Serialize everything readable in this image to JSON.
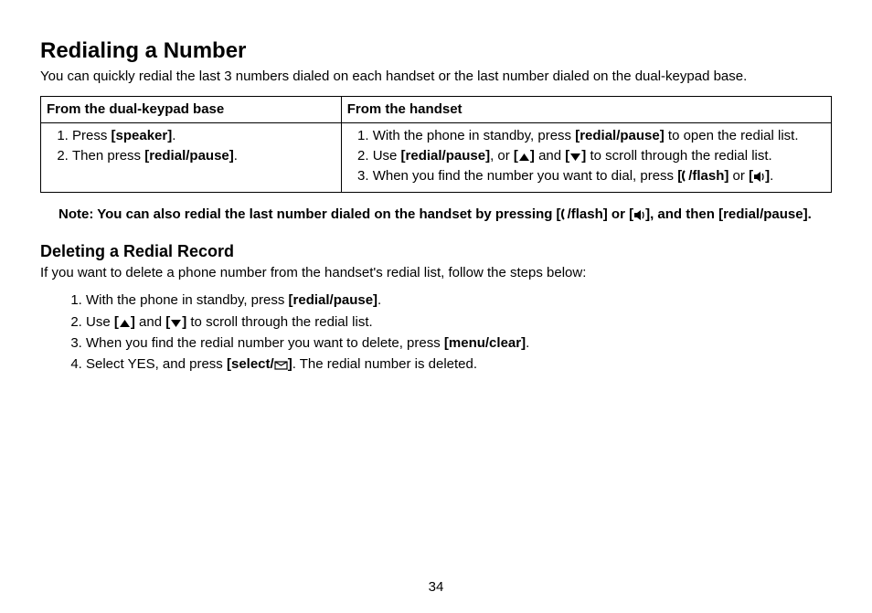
{
  "title": "Redialing a Number",
  "intro": "You can quickly redial the last 3 numbers dialed on each handset or the last number dialed on the dual-keypad base.",
  "table": {
    "head": [
      "From the dual-keypad base",
      "From the handset"
    ],
    "col1": {
      "s1a": "Press ",
      "s1b": "[speaker]",
      "s1c": ".",
      "s2a": "Then press ",
      "s2b": "[redial/pause]",
      "s2c": "."
    },
    "col2": {
      "s1a": "With the phone in standby, press ",
      "s1b": "[redial/pause]",
      "s1c": " to open the redial list.",
      "s2a": "Use ",
      "s2b": "[redial/pause]",
      "s2c": ", or ",
      "s2d_open": "[",
      "s2d_close": "]",
      "s2e": " and ",
      "s2f_open": "[",
      "s2f_close": "]",
      "s2g": " to scroll through the redial list.",
      "s3a": "When you find the number you want to dial, press ",
      "s3b_open": "[",
      "s3b_mid": "/flash]",
      "s3c": " or ",
      "s3d_open": "[",
      "s3d_close": "]",
      "s3e": "."
    }
  },
  "note": {
    "a": "Note: You can also redial the last number dialed on the handset by pressing [",
    "b": "/flash] or [",
    "c": "], and then [redial/pause]."
  },
  "delete": {
    "title": "Deleting a Redial Record",
    "intro": "If you want to delete a phone number from the handset's redial list, follow the steps below:",
    "s1a": "With the phone in standby, press ",
    "s1b": "[redial/pause]",
    "s1c": ".",
    "s2a": "Use ",
    "s2b_open": "[",
    "s2b_close": "]",
    "s2c": " and ",
    "s2d_open": "[",
    "s2d_close": "]",
    "s2e": " to scroll through the redial list.",
    "s3a": "When you find the redial number you want to delete, press ",
    "s3b": "[menu/clear]",
    "s3c": ".",
    "s4a": "Select YES, and press ",
    "s4b": "[select/",
    "s4c": "]",
    "s4d": ". The redial number is deleted."
  },
  "page": "34"
}
